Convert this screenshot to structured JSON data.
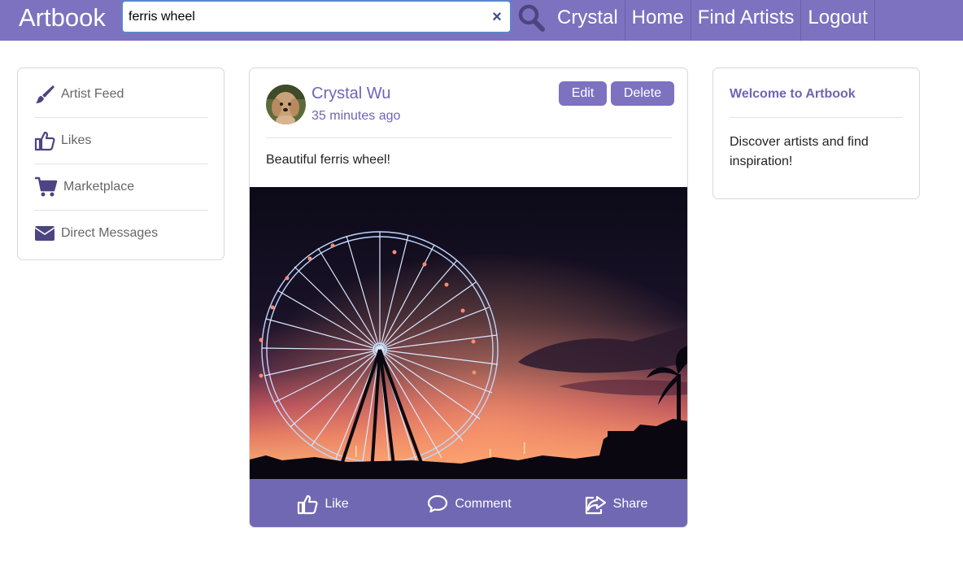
{
  "navbar": {
    "brand": "Artbook",
    "search": {
      "value": "ferris wheel",
      "placeholder": ""
    },
    "links": [
      "Crystal",
      "Home",
      "Find Artists",
      "Logout"
    ],
    "color": "#7c72c0"
  },
  "sidebar": {
    "items": [
      {
        "label": "Artist Feed",
        "icon": "paintbrush-icon"
      },
      {
        "label": "Likes",
        "icon": "thumbs-up-icon"
      },
      {
        "label": "Marketplace",
        "icon": "shopping-cart-icon"
      },
      {
        "label": "Direct Messages",
        "icon": "envelope-icon"
      }
    ]
  },
  "post": {
    "author": "Crystal Wu",
    "time": "35 minutes ago",
    "edit_label": "Edit",
    "delete_label": "Delete",
    "text": "Beautiful ferris wheel!",
    "actions": [
      {
        "label": "Like",
        "icon": "thumbs-up-icon"
      },
      {
        "label": "Comment",
        "icon": "comment-icon"
      },
      {
        "label": "Share",
        "icon": "share-icon"
      }
    ]
  },
  "welcome": {
    "title": "Welcome to Artbook",
    "text": "Discover artists and find inspiration!"
  }
}
